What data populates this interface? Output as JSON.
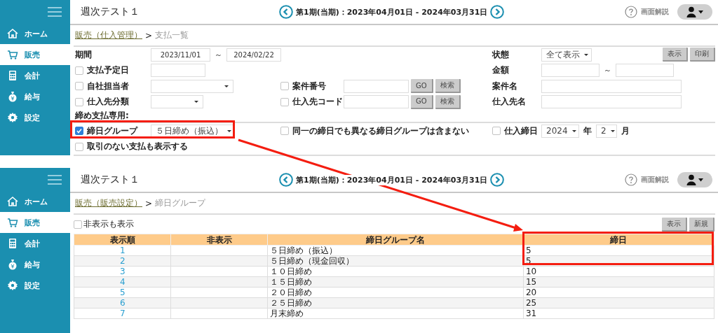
{
  "screens": [
    {
      "kind": "payment_list",
      "sidebar": {
        "items": [
          {
            "label": "ホーム",
            "selected": false
          },
          {
            "label": "販売",
            "selected": true
          },
          {
            "label": "会計",
            "selected": false
          },
          {
            "label": "給与",
            "selected": false
          },
          {
            "label": "設定",
            "selected": false
          }
        ]
      },
      "header": {
        "title": "週次テスト１",
        "period": "第1期(当期)：2023年04月01日 - 2024年03月31日",
        "help": "画面解説"
      },
      "breadcrumb": {
        "link": "販売（仕入管理）",
        "separator": ">",
        "current": "支払一覧"
      },
      "rows": [
        {
          "kind": "fields",
          "left": {
            "label": "期間",
            "kind": "date_range",
            "from": "2023/11/01",
            "separator": "～",
            "to": "2024/02/22"
          },
          "right": {
            "label": "状態",
            "kind": "select_small",
            "value": "全て表示"
          },
          "buttons": [
            "表示",
            "印刷"
          ]
        },
        {
          "kind": "fields",
          "left": {
            "label": "支払予定日",
            "checked": false,
            "kind": "text"
          },
          "right": {
            "label": "金額",
            "kind": "range",
            "separator": "～"
          }
        },
        {
          "kind": "fields",
          "left": {
            "label": "自社担当者",
            "checked": false,
            "kind": "select"
          },
          "middle": {
            "label": "案件番号",
            "checked": false,
            "kind": "code_search",
            "buttons": [
              "GO",
              "検索"
            ]
          },
          "right": {
            "label": "案件名",
            "kind": "text_wide"
          }
        },
        {
          "kind": "fields",
          "left": {
            "label": "仕入先分類",
            "checked": false,
            "kind": "select_short"
          },
          "middle": {
            "label": "仕入先コード",
            "checked": false,
            "kind": "code_search",
            "buttons": [
              "GO",
              "検索"
            ]
          },
          "right": {
            "label": "仕入先名",
            "kind": "text_wide"
          }
        },
        {
          "kind": "section",
          "label": "締め支払専用:"
        },
        {
          "kind": "fields",
          "left": {
            "label": "締日グループ",
            "checked": true,
            "kind": "select",
            "value": "５日締め（振込）"
          },
          "middle": {
            "label": "同一の締日でも異なる締日グループは含まない",
            "checked": false,
            "kind": "none"
          },
          "right": {
            "label": "仕入締日",
            "checked": false,
            "kind": "year_month",
            "year": "2024",
            "year_unit": "年",
            "month": "2",
            "month_unit": "月"
          }
        },
        {
          "kind": "fields",
          "left": {
            "label": "取引のない支払も表示する",
            "checked": false,
            "kind": "none"
          }
        }
      ]
    },
    {
      "kind": "closing_groups",
      "sidebar": {
        "items": [
          {
            "label": "ホーム",
            "selected": false
          },
          {
            "label": "販売",
            "selected": true
          },
          {
            "label": "会計",
            "selected": false
          },
          {
            "label": "給与",
            "selected": false
          },
          {
            "label": "設定",
            "selected": false
          }
        ]
      },
      "header": {
        "title": "週次テスト１",
        "period": "第1期(当期)：2023年04月01日 - 2024年03月31日",
        "help": "画面解説"
      },
      "breadcrumb": {
        "link": "販売（販売設定）",
        "separator": ">",
        "current": "締日グループ"
      },
      "show_hidden": {
        "label": "非表示も表示",
        "checked": false
      },
      "buttons": [
        "表示",
        "新規"
      ],
      "table": {
        "columns": [
          "表示順",
          "非表示",
          "締日グループ名",
          "締日"
        ],
        "rows": [
          {
            "order": "1",
            "name": "５日締め（振込）",
            "day": "5"
          },
          {
            "order": "2",
            "name": "５日締め（現金回収）",
            "day": "5"
          },
          {
            "order": "3",
            "name": "１０日締め",
            "day": "10"
          },
          {
            "order": "4",
            "name": "１５日締め",
            "day": "15"
          },
          {
            "order": "5",
            "name": "２０日締め",
            "day": "20"
          },
          {
            "order": "6",
            "name": "２５日締め",
            "day": "25"
          },
          {
            "order": "7",
            "name": "月末締め",
            "day": "31"
          }
        ]
      }
    }
  ]
}
